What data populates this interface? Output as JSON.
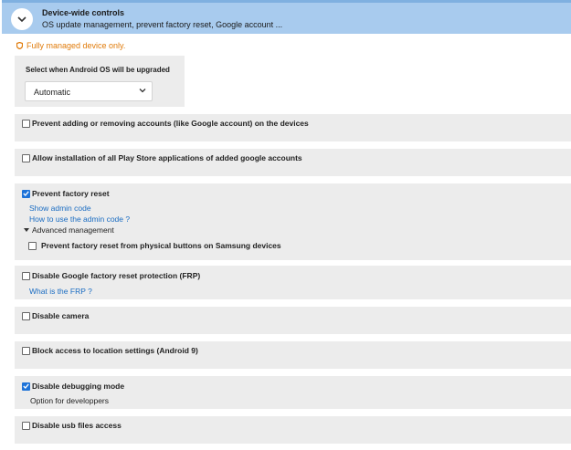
{
  "section": {
    "title": "Device-wide controls",
    "subtitle": "OS update management, prevent factory reset, Google account ..."
  },
  "warning": {
    "text": "Fully managed device only.",
    "color": "#e07b0a"
  },
  "os_upgrade": {
    "label": "Select when Android OS will be upgraded",
    "selected": "Automatic"
  },
  "options": {
    "prevent_accounts": {
      "label": "Prevent adding or removing accounts (like Google account) on the devices",
      "checked": false
    },
    "allow_play_store": {
      "label": "Allow installation of all Play Store applications of added google accounts",
      "checked": false
    },
    "prevent_factory_reset": {
      "label": "Prevent factory reset",
      "checked": true,
      "link_show_admin": "Show admin code",
      "link_how_to": "How to use the admin code ?",
      "advanced_label": "Advanced management",
      "samsung_label": "Prevent factory reset from physical buttons on Samsung devices",
      "samsung_checked": false
    },
    "disable_frp": {
      "label": "Disable Google factory reset protection (FRP)",
      "checked": false,
      "link": "What is the FRP ?"
    },
    "disable_camera": {
      "label": "Disable camera",
      "checked": false
    },
    "block_location": {
      "label": "Block access to location settings (Android 9)",
      "checked": false
    },
    "disable_debugging": {
      "label": "Disable debugging mode",
      "checked": true,
      "note": "Option for developpers"
    },
    "disable_usb": {
      "label": "Disable usb files access",
      "checked": false
    }
  },
  "colors": {
    "accent": "#1e73d8",
    "header_bg": "#a8cbee",
    "panel_bg": "#ececec",
    "link": "#1a6cc2"
  }
}
